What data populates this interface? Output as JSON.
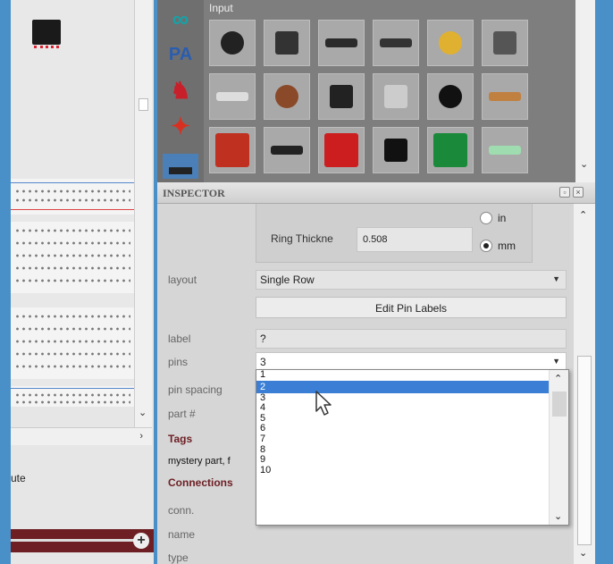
{
  "left_pane": {
    "route_label": "ute"
  },
  "parts_bin": {
    "category_title": "Input",
    "tabs": [
      {
        "name": "arduino-tab",
        "glyph": "∞",
        "color": "#19a0a6"
      },
      {
        "name": "pa-tab",
        "glyph": "PA",
        "color": "#2a5db0"
      },
      {
        "name": "sparkfun-tab",
        "glyph": "♞",
        "color": "#c8202a"
      },
      {
        "name": "fritzing-tab",
        "glyph": "✦",
        "color": "#d83020"
      },
      {
        "name": "mine-tab",
        "glyph": "▬",
        "color": "#222"
      }
    ],
    "parts": [
      {
        "name": "rotary-encoder",
        "color": "#222"
      },
      {
        "name": "slide-potentiometer",
        "color": "#333"
      },
      {
        "name": "slide-switch",
        "color": "#2a2a2a"
      },
      {
        "name": "dip-switch",
        "color": "#333"
      },
      {
        "name": "trimmer-potentiometer",
        "color": "#e0b030"
      },
      {
        "name": "rotary-potentiometer",
        "color": "#555"
      },
      {
        "name": "fuse",
        "color": "#ddd"
      },
      {
        "name": "pushbutton",
        "color": "#8a4a2a"
      },
      {
        "name": "toggle-switch",
        "color": "#222"
      },
      {
        "name": "tilt-switch",
        "color": "#ccc"
      },
      {
        "name": "piezo-sensor",
        "color": "#111"
      },
      {
        "name": "wire",
        "color": "#c08040"
      },
      {
        "name": "reed-relay",
        "color": "#c03020"
      },
      {
        "name": "ir-sensor",
        "color": "#222"
      },
      {
        "name": "sparkfun-breakout",
        "color": "#cc1e1e"
      },
      {
        "name": "temperature-sensor",
        "color": "#111"
      },
      {
        "name": "green-breakout",
        "color": "#1a8a3a"
      },
      {
        "name": "reed-switch",
        "color": "#9fdcb0"
      }
    ]
  },
  "inspector": {
    "title": "INSPECTOR",
    "ring": {
      "label": "Ring Thickne",
      "value": "0.508",
      "unit_in": "in",
      "unit_mm": "mm",
      "selected_unit": "mm"
    },
    "layout": {
      "label": "layout",
      "value": "Single Row"
    },
    "edit_pin_labels": "Edit Pin Labels",
    "label_row": {
      "label": "label",
      "value": "?"
    },
    "pins_row": {
      "label": "pins",
      "value": "3"
    },
    "pin_spacing_row": {
      "label": "pin spacing"
    },
    "part_row": {
      "label": "part #"
    },
    "tags_title": "Tags",
    "tags_value": "mystery part, f",
    "connections_title": "Connections",
    "conn_row": {
      "label": "conn."
    },
    "name_row": {
      "label": "name"
    },
    "type_row": {
      "label": "type"
    }
  },
  "pins_dropdown": {
    "options": [
      "1",
      "2",
      "3",
      "4",
      "5",
      "6",
      "7",
      "8",
      "9",
      "10"
    ],
    "selected": "2"
  }
}
